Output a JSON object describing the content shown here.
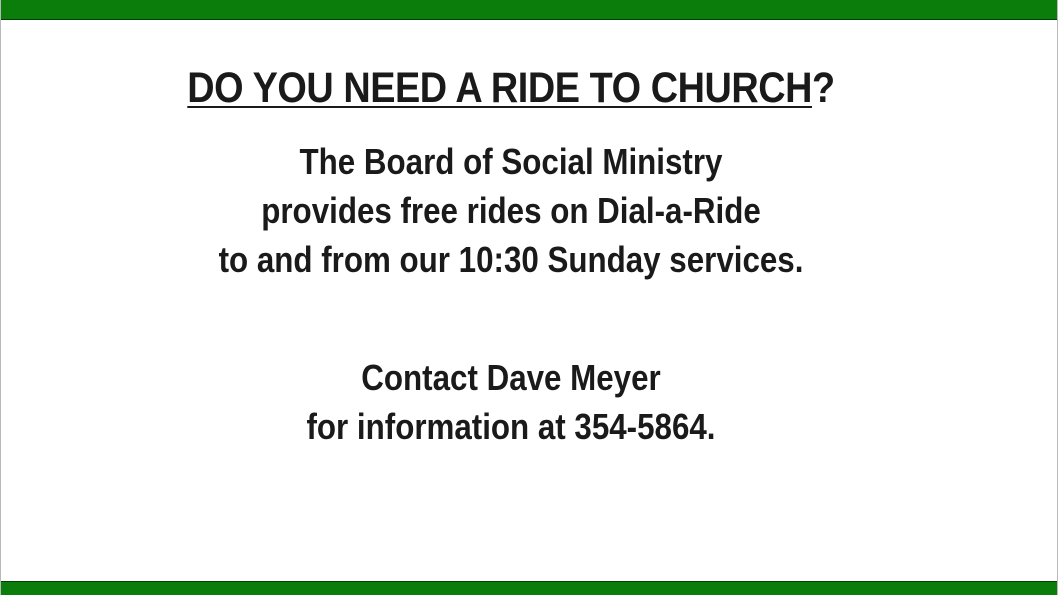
{
  "slide": {
    "heading_main": "DO YOU NEED A RIDE TO CHURCH",
    "heading_end": "?",
    "paragraph1": [
      "The Board of Social Ministry",
      "provides free rides on Dial-a-Ride",
      "to and from our 10:30 Sunday services."
    ],
    "paragraph2": [
      "Contact Dave Meyer",
      "for information at 354-5864."
    ]
  },
  "colors": {
    "accent_bar": "#0a7d0a",
    "text": "#1a1a1a",
    "background": "#ffffff"
  }
}
